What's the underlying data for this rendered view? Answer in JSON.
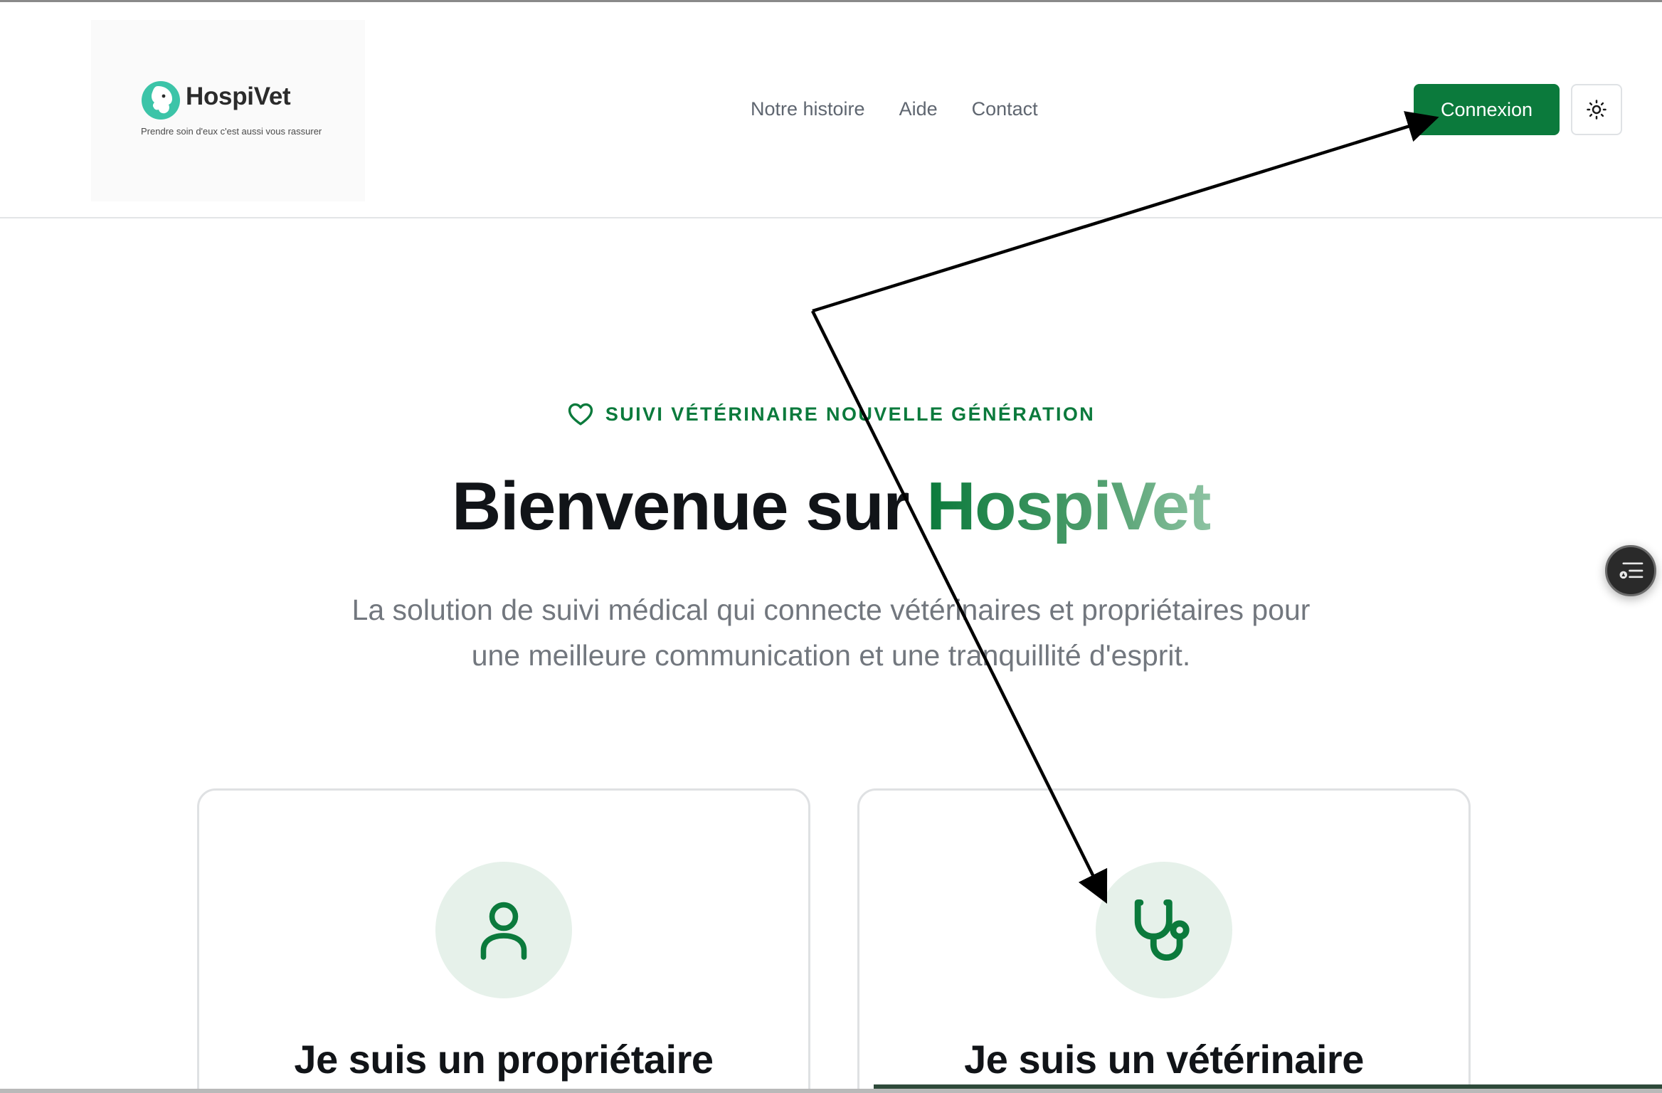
{
  "brand": {
    "name": "HospiVet",
    "tagline": "Prendre soin d'eux c'est aussi vous rassurer",
    "accent_color": "#0b7a3c",
    "logo_color": "#3cc4a8"
  },
  "nav": {
    "items": [
      {
        "label": "Notre histoire"
      },
      {
        "label": "Aide"
      },
      {
        "label": "Contact"
      }
    ]
  },
  "header": {
    "login_label": "Connexion",
    "theme_icon": "sun-icon"
  },
  "hero": {
    "eyebrow_icon": "heart-icon",
    "eyebrow": "SUIVI VÉTÉRINAIRE NOUVELLE GÉNÉRATION",
    "title_prefix": "Bienvenue sur ",
    "title_accent": "HospiVet",
    "subtitle": "La solution de suivi médical qui connecte vétérinaires et propriétaires pour une meilleure communication et une tranquillité d'esprit."
  },
  "cards": [
    {
      "icon": "user-icon",
      "title": "Je suis un propriétaire"
    },
    {
      "icon": "stethoscope-icon",
      "title": "Je suis un vétérinaire"
    }
  ],
  "floating": {
    "icon": "toc-icon"
  },
  "annotation": {
    "color": "#000000"
  }
}
